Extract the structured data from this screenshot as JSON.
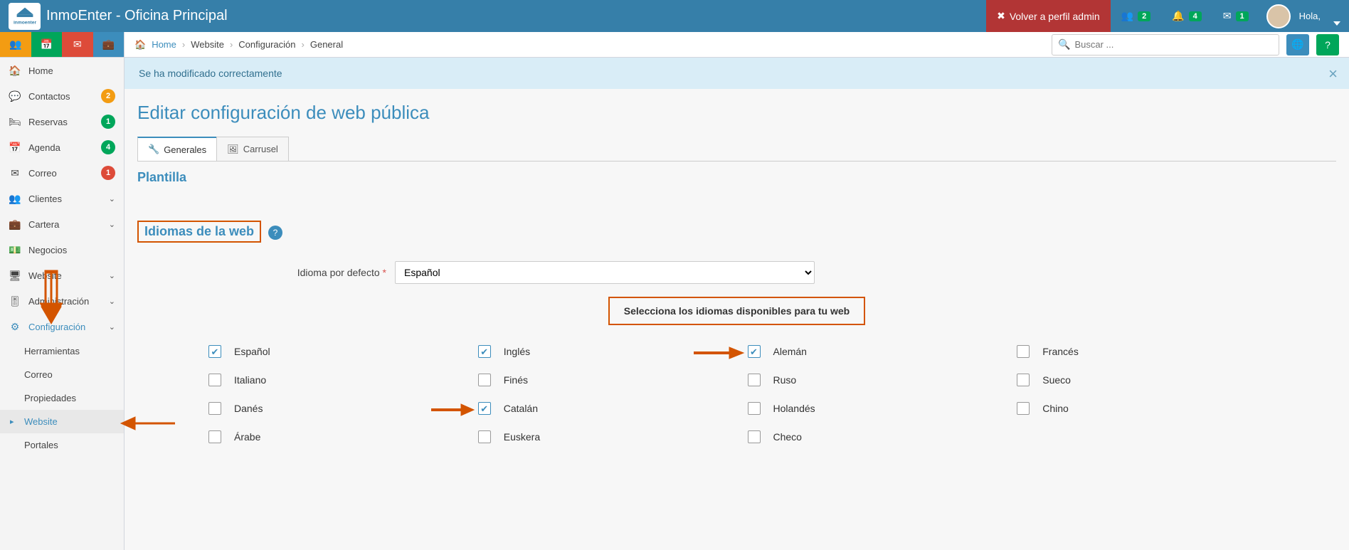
{
  "header": {
    "app_title": "InmoEnter - Oficina Principal",
    "back_admin": "Volver a perfil admin",
    "badge_users": "2",
    "badge_bell": "4",
    "badge_mail": "1",
    "hola": "Hola,"
  },
  "search": {
    "placeholder": "Buscar ..."
  },
  "breadcrumb": {
    "home": "Home",
    "lvl1": "Website",
    "lvl2": "Configuración",
    "lvl3": "General"
  },
  "sidebar": {
    "home": "Home",
    "contactos": "Contactos",
    "contactos_badge": "2",
    "reservas": "Reservas",
    "reservas_badge": "1",
    "agenda": "Agenda",
    "agenda_badge": "4",
    "correo": "Correo",
    "correo_badge": "1",
    "clientes": "Clientes",
    "cartera": "Cartera",
    "negocios": "Negocios",
    "website": "Website",
    "administracion": "Administración",
    "configuracion": "Configuración",
    "sub": {
      "herramientas": "Herramientas",
      "correo": "Correo",
      "propiedades": "Propiedades",
      "website": "Website",
      "portales": "Portales"
    }
  },
  "alert": "Se ha modificado correctamente",
  "page": {
    "title": "Editar configuración de web pública",
    "tab_generales": "Generales",
    "tab_carrusel": "Carrusel",
    "sec_plantilla": "Plantilla",
    "sec_idiomas": "Idiomas de la web",
    "lbl_default_lang": "Idioma por defecto",
    "default_lang_value": "Español",
    "banner": "Selecciona los idiomas disponibles para tu web",
    "langs": {
      "es": "Español",
      "en": "Inglés",
      "de": "Alemán",
      "fr": "Francés",
      "it": "Italiano",
      "fi": "Finés",
      "ru": "Ruso",
      "sv": "Sueco",
      "da": "Danés",
      "ca": "Catalán",
      "nl": "Holandés",
      "zh": "Chino",
      "ar": "Árabe",
      "eu": "Euskera",
      "cs": "Checo"
    }
  }
}
